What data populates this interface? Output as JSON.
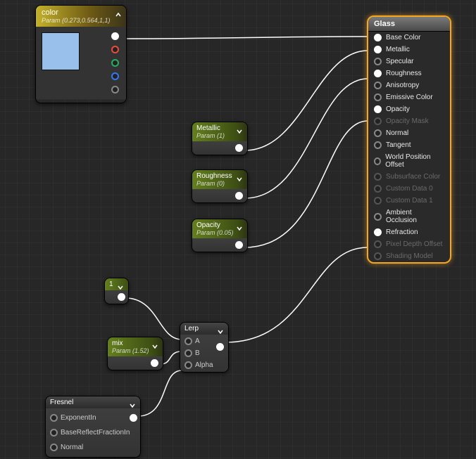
{
  "nodes": {
    "color": {
      "title": "color",
      "subtitle": "Param (0.273,0.564,1,1)",
      "swatch": "#99c0eb"
    },
    "metallic": {
      "title": "Metallic",
      "subtitle": "Param (1)"
    },
    "roughness": {
      "title": "Roughness",
      "subtitle": "Param (0)"
    },
    "opacity": {
      "title": "Opacity",
      "subtitle": "Param (0.05)"
    },
    "one": {
      "title": "1"
    },
    "mix": {
      "title": "mix",
      "subtitle": "Param (1.52)"
    },
    "lerp": {
      "title": "Lerp",
      "in_a": "A",
      "in_b": "B",
      "in_alpha": "Alpha"
    },
    "fresnel": {
      "title": "Fresnel",
      "in_exp": "ExponentIn",
      "in_base": "BaseReflectFractionIn",
      "in_normal": "Normal"
    }
  },
  "result": {
    "title": "Glass",
    "pins": [
      {
        "label": "Base Color",
        "connected": true,
        "muted": false
      },
      {
        "label": "Metallic",
        "connected": true,
        "muted": false
      },
      {
        "label": "Specular",
        "connected": false,
        "muted": false
      },
      {
        "label": "Roughness",
        "connected": true,
        "muted": false
      },
      {
        "label": "Anisotropy",
        "connected": false,
        "muted": false
      },
      {
        "label": "Emissive Color",
        "connected": false,
        "muted": false
      },
      {
        "label": "Opacity",
        "connected": true,
        "muted": false
      },
      {
        "label": "Opacity Mask",
        "connected": false,
        "muted": true
      },
      {
        "label": "Normal",
        "connected": false,
        "muted": false
      },
      {
        "label": "Tangent",
        "connected": false,
        "muted": false
      },
      {
        "label": "World Position Offset",
        "connected": false,
        "muted": false
      },
      {
        "label": "Subsurface Color",
        "connected": false,
        "muted": true
      },
      {
        "label": "Custom Data 0",
        "connected": false,
        "muted": true
      },
      {
        "label": "Custom Data 1",
        "connected": false,
        "muted": true
      },
      {
        "label": "Ambient Occlusion",
        "connected": false,
        "muted": false
      },
      {
        "label": "Refraction",
        "connected": true,
        "muted": false
      },
      {
        "label": "Pixel Depth Offset",
        "connected": false,
        "muted": true
      },
      {
        "label": "Shading Model",
        "connected": false,
        "muted": true
      }
    ]
  }
}
